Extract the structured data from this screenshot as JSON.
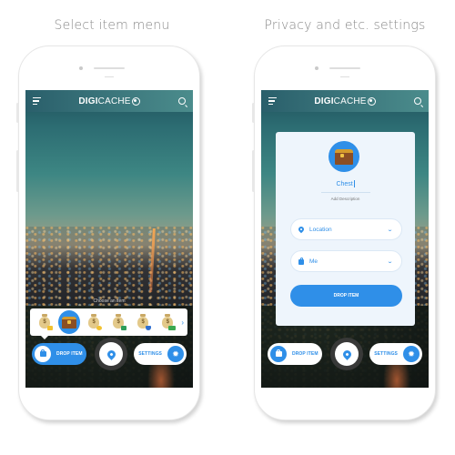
{
  "captions": {
    "left": "Select item menu",
    "right": "Privacy and etc. settings"
  },
  "app": {
    "logo_bold": "DIGI",
    "logo_light": "CACHE",
    "menu_icon": "hamburger-menu-icon",
    "search_icon": "search-icon"
  },
  "left_screen": {
    "choose_label": "Choose an item",
    "items": [
      {
        "name": "money-bag-coin",
        "icon": "money-bag-icon",
        "badge_color": "#f2c230"
      },
      {
        "name": "treasure-chest",
        "icon": "treasure-chest-icon",
        "selected": true
      },
      {
        "name": "money-bag-coins",
        "icon": "money-bag-icon",
        "badge_color": "#f2c230"
      },
      {
        "name": "money-bag-cash",
        "icon": "money-bag-icon",
        "badge_color": "#2e9d5a"
      },
      {
        "name": "money-bag-shield",
        "icon": "money-bag-icon",
        "badge_color": "#2f6fd0"
      },
      {
        "name": "money-bag-bills",
        "icon": "money-bag-icon",
        "badge_color": "#3aa84f"
      }
    ],
    "next_icon": "chevron-right-icon"
  },
  "right_screen": {
    "item_name": "Chest",
    "description_placeholder": "Add Description",
    "location_field": "Location",
    "privacy_field": "Me",
    "drop_button": "DROP ITEM"
  },
  "bottom_bar": {
    "drop_label": "DROP ITEM",
    "settings_label": "SETTINGS",
    "gear_glyph": "✹"
  },
  "colors": {
    "accent": "#2f8fe8",
    "header_start": "#2a5f6b",
    "header_end": "#4b8c8c",
    "card_bg": "#eef5fc"
  }
}
